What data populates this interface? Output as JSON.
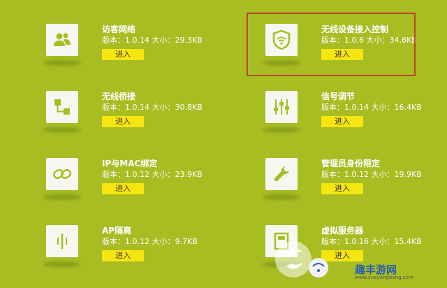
{
  "apps": [
    {
      "id": "guest-network",
      "name": "访客网络",
      "version": "版本：1.0.14 大小：29.3KB",
      "button": "进入",
      "icon": "guest-users-icon"
    },
    {
      "id": "wireless-access-control",
      "name": "无线设备接入控制",
      "version": "版本：1.0.6 大小：34.6KB",
      "button": "进入",
      "icon": "wifi-shield-icon"
    },
    {
      "id": "wireless-bridge",
      "name": "无线桥接",
      "version": "版本：1.0.14 大小：30.8KB",
      "button": "进入",
      "icon": "bridge-nodes-icon"
    },
    {
      "id": "signal-tuning",
      "name": "信号调节",
      "version": "版本：1.0.14 大小：16.4KB",
      "button": "进入",
      "icon": "sliders-icon"
    },
    {
      "id": "ip-mac-binding",
      "name": "IP与MAC绑定",
      "version": "版本：1.0.12 大小：23.9KB",
      "button": "进入",
      "icon": "chain-link-icon"
    },
    {
      "id": "admin-restriction",
      "name": "管理员身份限定",
      "version": "版本：1.0.12 大小：19.9KB",
      "button": "进入",
      "icon": "wrench-icon"
    },
    {
      "id": "ap-isolation",
      "name": "AP隔离",
      "version": "版本：1.0.12 大小：9.7KB",
      "button": "进入",
      "icon": "isolation-icon"
    },
    {
      "id": "virtual-server",
      "name": "虚拟服务器",
      "version": "版本：1.0.16 大小：15.4KB",
      "button": "进入",
      "icon": "server-icon"
    }
  ],
  "watermark": {
    "text": "趣丰游网",
    "url": "www.yueyangbang.com"
  },
  "colors": {
    "background": "#a7bd22",
    "button": "#f7e512",
    "highlight": "#b5482c",
    "icon": "#a7bd22"
  }
}
